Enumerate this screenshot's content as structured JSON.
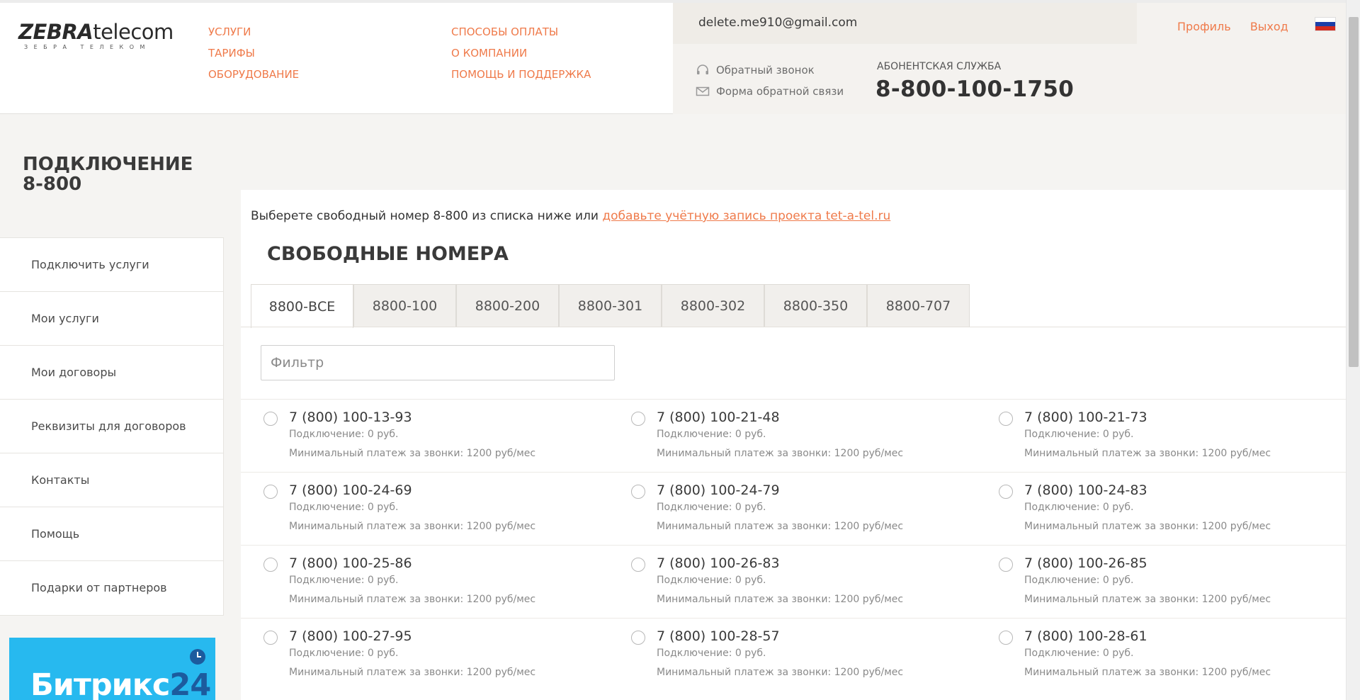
{
  "header": {
    "logo_brand": "ZEBRA",
    "logo_suffix": "telecom",
    "logo_sub": "ЗЕБРА ТЕЛЕКОМ",
    "nav_col1": [
      "УСЛУГИ",
      "ТАРИФЫ",
      "ОБОРУДОВАНИЕ"
    ],
    "nav_col2": [
      "СПОСОБЫ ОПЛАТЫ",
      "О КОМПАНИИ",
      "ПОМОЩЬ И ПОДДЕРЖКА"
    ],
    "email": "delete.me910@gmail.com",
    "profile_label": "Профиль",
    "logout_label": "Выход",
    "callback_label": "Обратный звонок",
    "feedback_label": "Форма обратной связи",
    "service_label": "АБОНЕНТСКАЯ СЛУЖБА",
    "service_phone": "8-800-100-1750",
    "accent_color": "#ef7a4a"
  },
  "page": {
    "title": "ПОДКЛЮЧЕНИЕ 8-800"
  },
  "sidebar": {
    "items": [
      {
        "label": "Подключить услуги"
      },
      {
        "label": "Мои услуги"
      },
      {
        "label": "Мои договоры"
      },
      {
        "label": "Реквизиты для договоров"
      },
      {
        "label": "Контакты"
      },
      {
        "label": "Помощь"
      },
      {
        "label": "Подарки от партнеров"
      }
    ],
    "promo_text_a": "Битрикс",
    "promo_text_b": "24"
  },
  "main": {
    "intro_text": "Выберете свободный номер 8-800 из списка ниже или ",
    "intro_link": "добавьте учётную запись проекта tet-a-tel.ru",
    "section_title": "СВОБОДНЫЕ НОМЕРА",
    "tabs": [
      {
        "label": "8800-ВСЕ",
        "active": true
      },
      {
        "label": "8800-100",
        "active": false
      },
      {
        "label": "8800-200",
        "active": false
      },
      {
        "label": "8800-301",
        "active": false
      },
      {
        "label": "8800-302",
        "active": false
      },
      {
        "label": "8800-350",
        "active": false
      },
      {
        "label": "8800-707",
        "active": false
      }
    ],
    "filter_placeholder": "Фильтр",
    "connection_text": "Подключение: 0 руб.",
    "min_payment_text": "Минимальный платеж за звонки: 1200 руб/мес",
    "numbers": [
      "7 (800) 100-13-93",
      "7 (800) 100-21-48",
      "7 (800) 100-21-73",
      "7 (800) 100-24-69",
      "7 (800) 100-24-79",
      "7 (800) 100-24-83",
      "7 (800) 100-25-86",
      "7 (800) 100-26-83",
      "7 (800) 100-26-85",
      "7 (800) 100-27-95",
      "7 (800) 100-28-57",
      "7 (800) 100-28-61"
    ]
  }
}
